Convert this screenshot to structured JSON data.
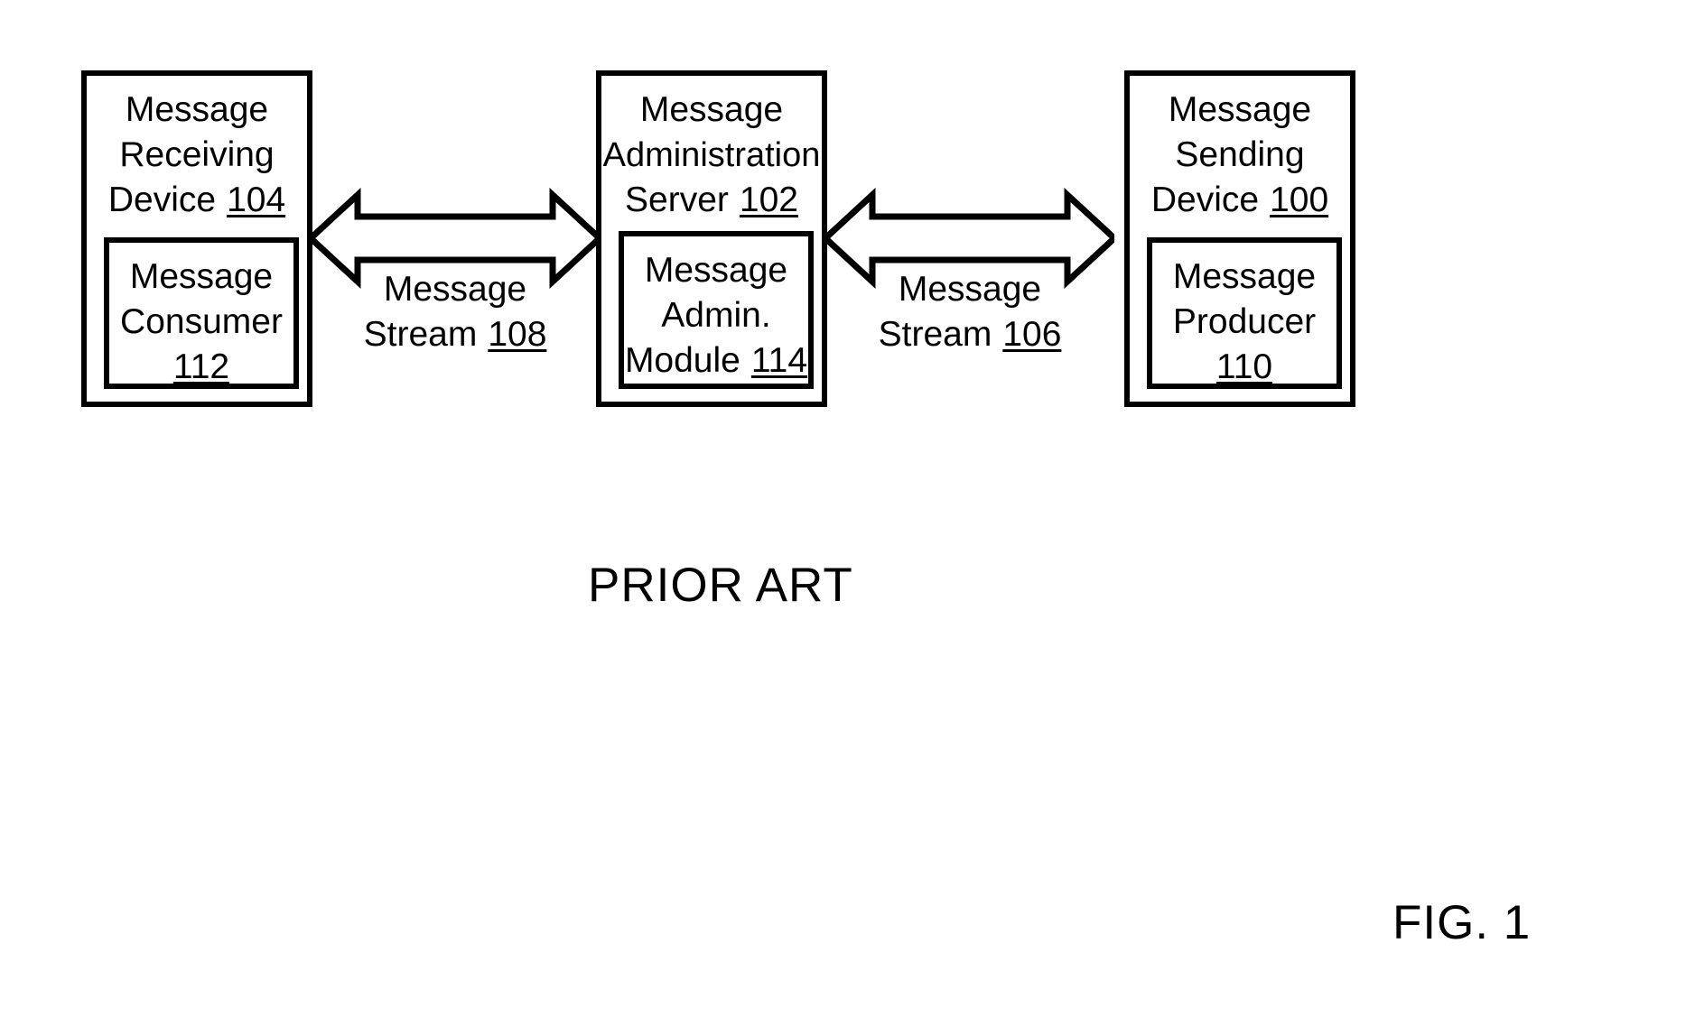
{
  "figure": {
    "prior_art_label": "PRIOR ART",
    "figure_label": "FIG. 1",
    "line_color": "#000000",
    "background_color": "#ffffff"
  },
  "nodes": {
    "receiving_device": {
      "title_line1": "Message",
      "title_line2": "Receiving",
      "title_line3_text": "Device",
      "title_line3_ref": "104",
      "inner": {
        "line1": "Message",
        "line2": "Consumer",
        "ref": "112"
      }
    },
    "administration_server": {
      "title_line1": "Message",
      "title_line2": "Administration",
      "title_line3_text": "Server",
      "title_line3_ref": "102",
      "inner": {
        "line1": "Message",
        "line2": "Admin.",
        "line3_text": "Module",
        "line3_ref": "114"
      }
    },
    "sending_device": {
      "title_line1": "Message",
      "title_line2": "Sending",
      "title_line3_text": "Device",
      "title_line3_ref": "100",
      "inner": {
        "line1": "Message",
        "line2": "Producer",
        "ref": "110"
      }
    }
  },
  "connectors": {
    "left_stream": {
      "line1": "Message",
      "line2_text": "Stream",
      "line2_ref": "108",
      "direction": "bidirectional"
    },
    "right_stream": {
      "line1": "Message",
      "line2_text": "Stream",
      "line2_ref": "106",
      "direction": "bidirectional"
    }
  }
}
